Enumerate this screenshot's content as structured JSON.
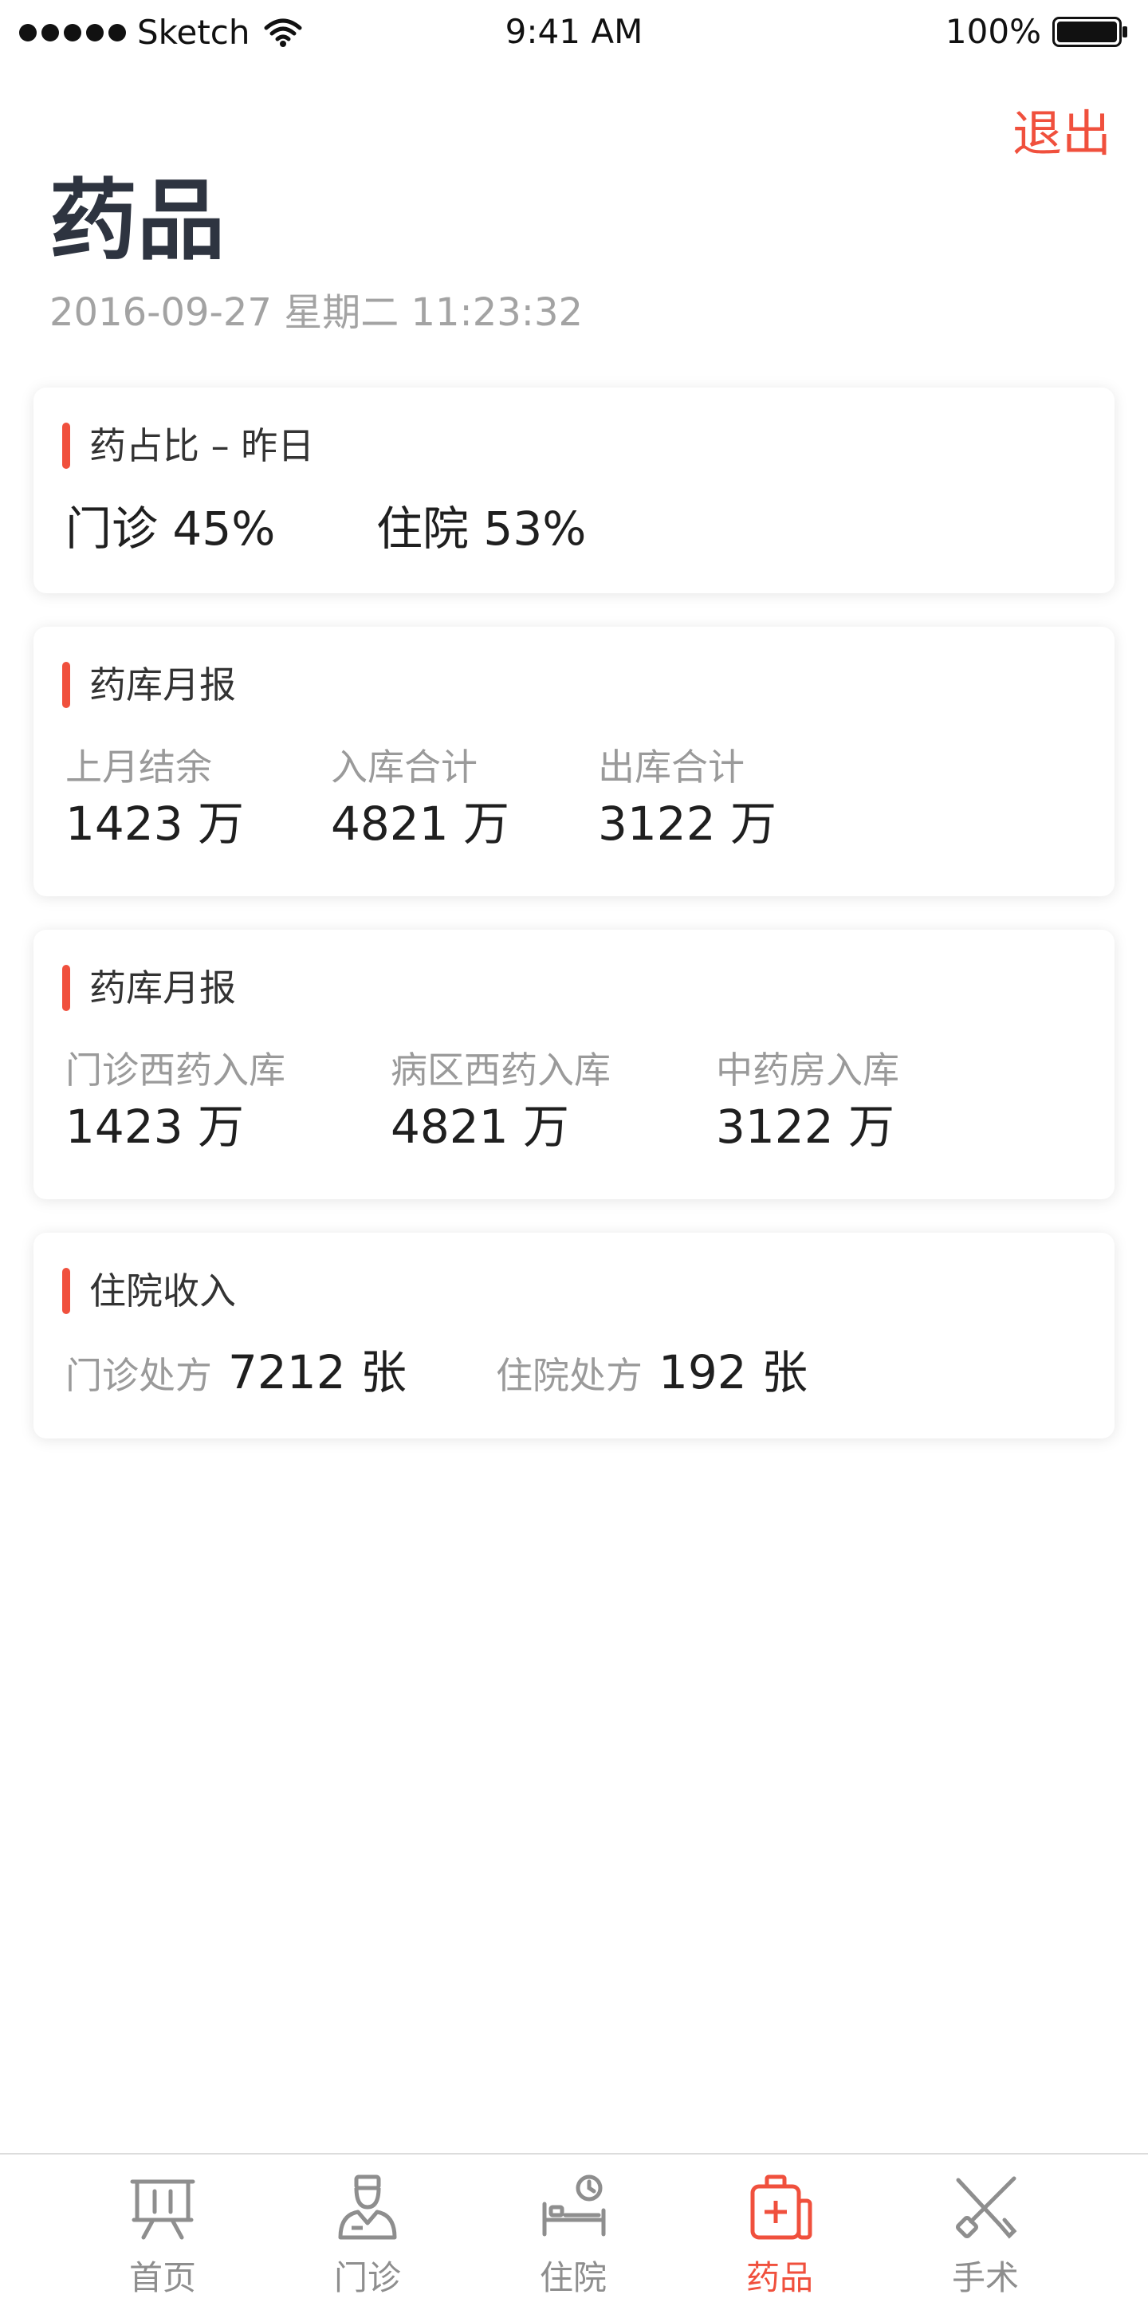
{
  "status_bar": {
    "carrier": "Sketch",
    "time": "9:41 AM",
    "battery": "100%"
  },
  "header": {
    "logout_label": "退出",
    "title": "药品",
    "datetime": "2016-09-27  星期二  11:23:32"
  },
  "cards": {
    "drug_ratio": {
      "title": "药占比 – 昨日",
      "items": [
        {
          "text": "门诊 45%"
        },
        {
          "text": "住院 53%"
        }
      ]
    },
    "pharmacy_report_1": {
      "title": "药库月报",
      "items": [
        {
          "label": "上月结余",
          "value": "1423 万"
        },
        {
          "label": "入库合计",
          "value": "4821 万"
        },
        {
          "label": "出库合计",
          "value": "3122 万"
        }
      ]
    },
    "pharmacy_report_2": {
      "title": "药库月报",
      "items": [
        {
          "label": "门诊西药入库",
          "value": "1423 万"
        },
        {
          "label": "病区西药入库",
          "value": "4821 万"
        },
        {
          "label": "中药房入库",
          "value": "3122 万"
        }
      ]
    },
    "inpatient_income": {
      "title": "住院收入",
      "items": [
        {
          "label": "门诊处方",
          "value": "7212 张"
        },
        {
          "label": "住院处方",
          "value": "192 张"
        }
      ]
    }
  },
  "tabbar": {
    "tabs": [
      {
        "label": "首页",
        "icon": "presentation-board-icon"
      },
      {
        "label": "门诊",
        "icon": "doctor-icon"
      },
      {
        "label": "住院",
        "icon": "hospital-bed-icon"
      },
      {
        "label": "药品",
        "icon": "medicine-kit-icon",
        "active": true
      },
      {
        "label": "手术",
        "icon": "surgery-tools-icon"
      }
    ]
  },
  "colors": {
    "accent": "#f0503d",
    "title": "#2e3440",
    "muted": "#9a9a9a",
    "tab_inactive": "#8e8e8e"
  }
}
